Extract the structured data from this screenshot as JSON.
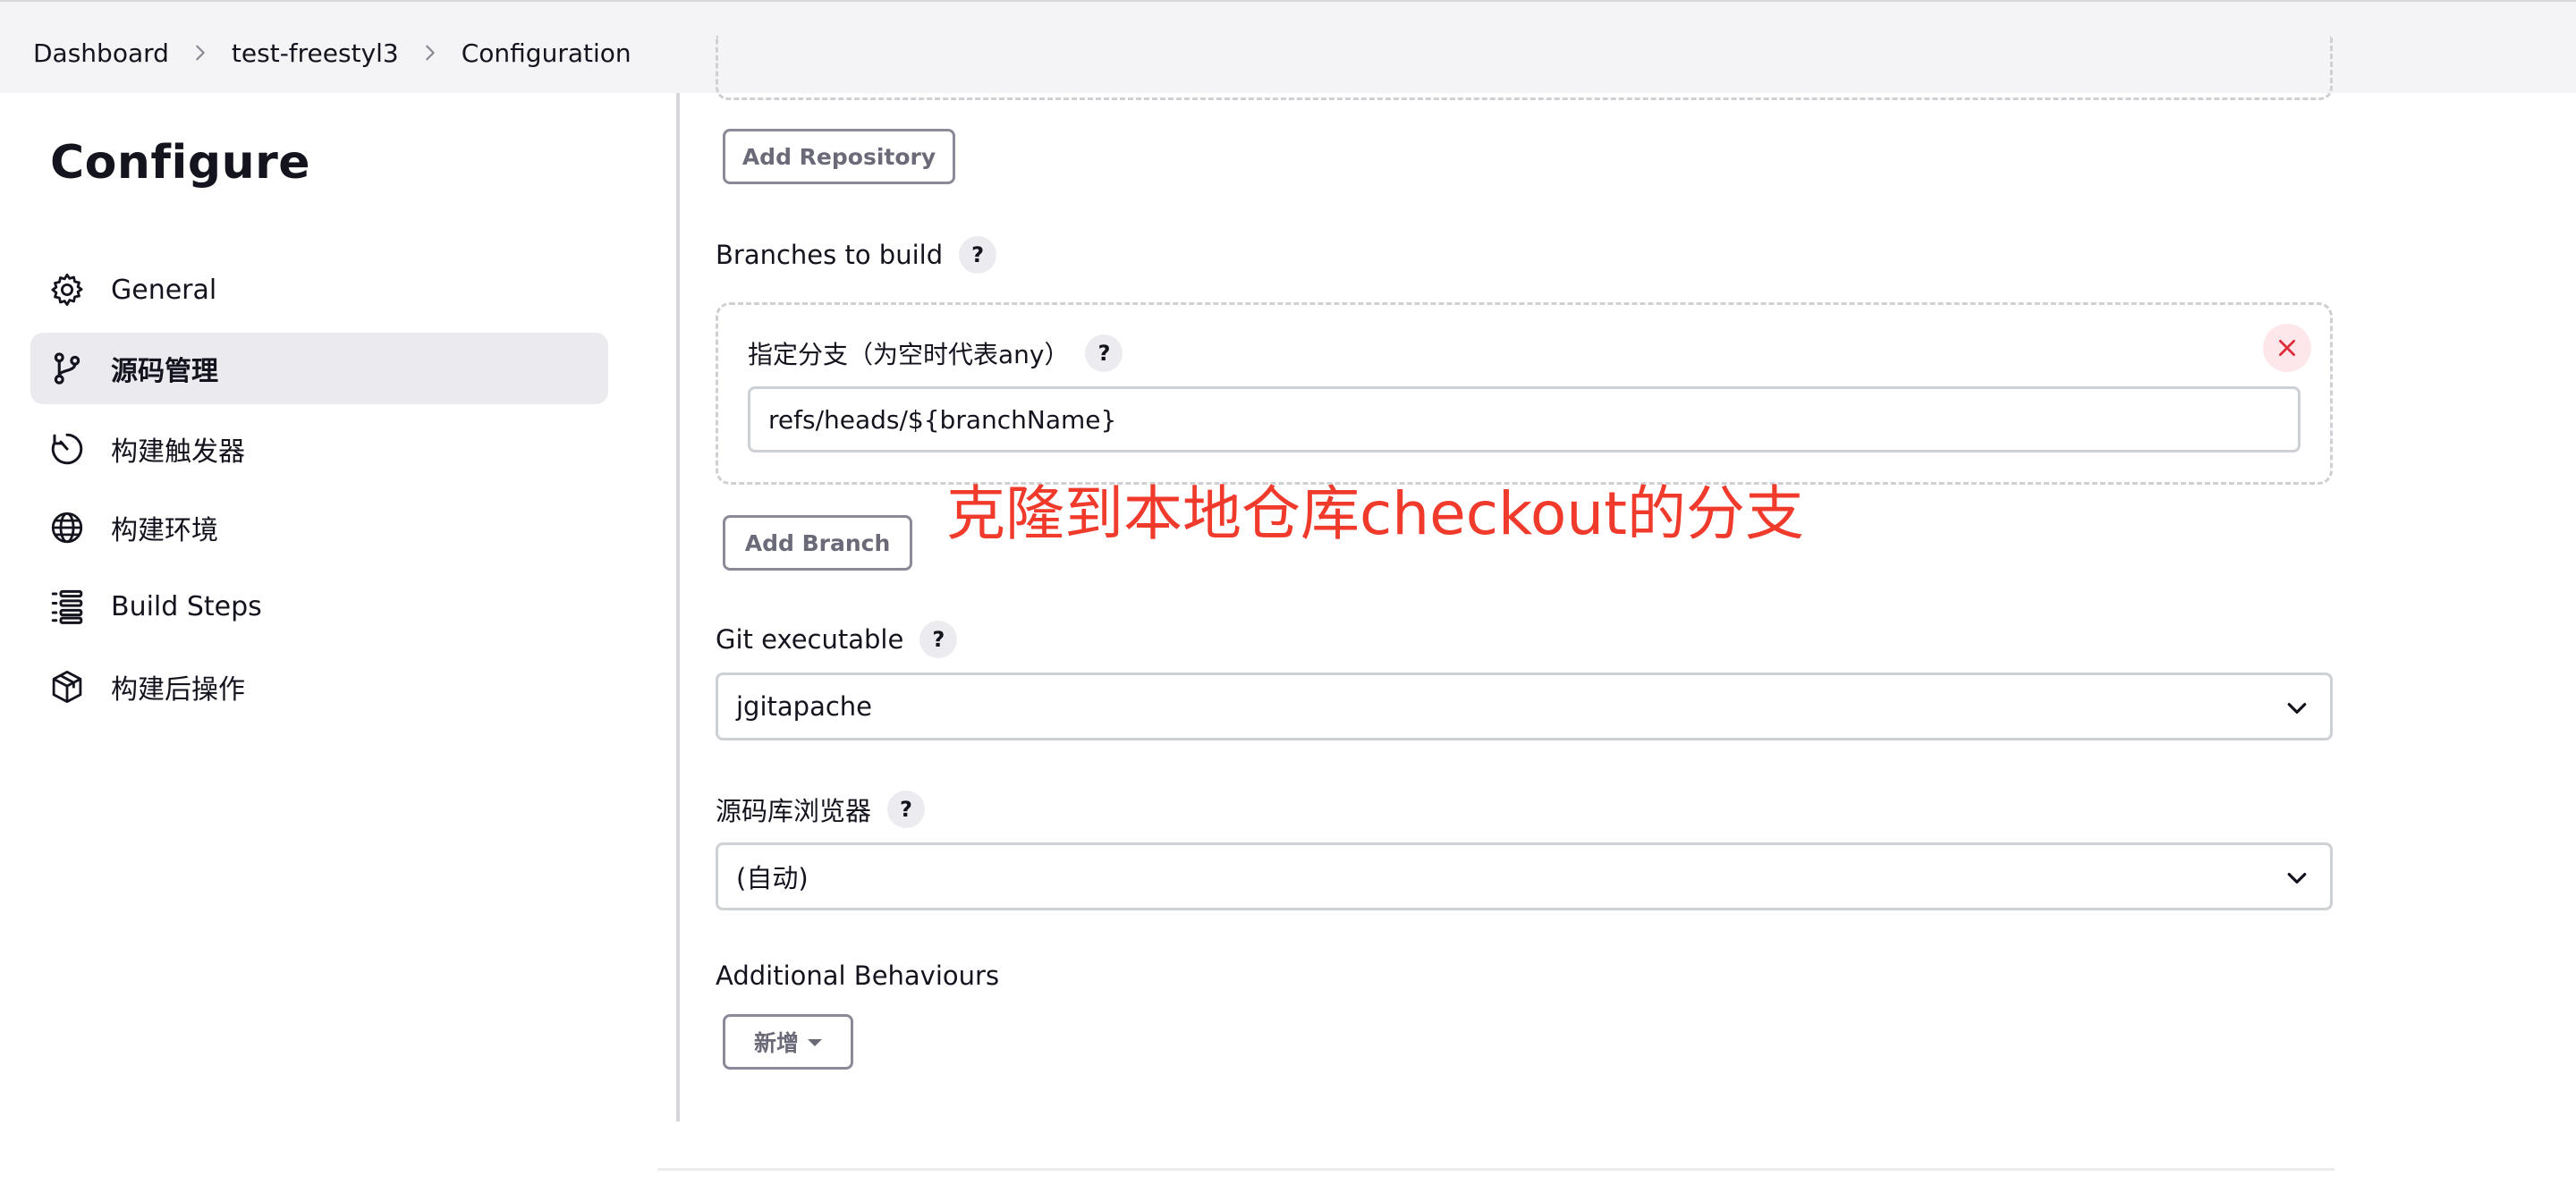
{
  "breadcrumb": {
    "items": [
      "Dashboard",
      "test-freestyl3",
      "Configuration"
    ]
  },
  "sidebar": {
    "title": "Configure",
    "items": [
      {
        "label": "General",
        "icon": "gear-icon",
        "active": false
      },
      {
        "label": "源码管理",
        "icon": "branch-icon",
        "active": true
      },
      {
        "label": "构建触发器",
        "icon": "clock-icon",
        "active": false
      },
      {
        "label": "构建环境",
        "icon": "globe-icon",
        "active": false
      },
      {
        "label": "Build Steps",
        "icon": "list-icon",
        "active": false
      },
      {
        "label": "构建后操作",
        "icon": "package-icon",
        "active": false
      }
    ]
  },
  "scm": {
    "add_repository_label": "Add Repository",
    "branches_label": "Branches to build",
    "branch_spec_label": "指定分支（为空时代表any）",
    "branch_spec_value": "refs/heads/${branchName}",
    "add_branch_label": "Add Branch",
    "annotation": "克隆到本地仓库checkout的分支",
    "git_executable_label": "Git executable",
    "git_executable_value": "jgitapache",
    "repo_browser_label": "源码库浏览器",
    "repo_browser_value": "(自动)",
    "additional_behaviours_label": "Additional Behaviours",
    "add_behaviour_label": "新增",
    "help_glyph": "?"
  },
  "colors": {
    "annotation": "#f03a2b",
    "active_bg": "#ebebef",
    "close_red": "#e02d3c"
  }
}
